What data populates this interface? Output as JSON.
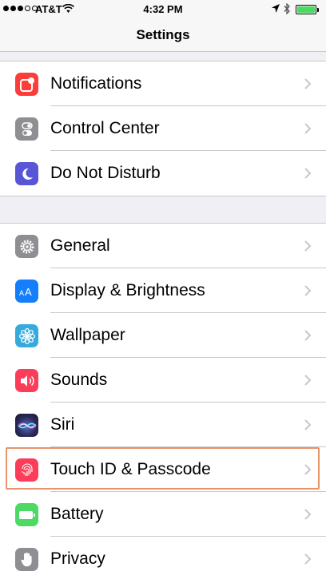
{
  "status_bar": {
    "carrier": "AT&T",
    "time": "4:32 PM",
    "signal_bars": 3,
    "signal_total": 5,
    "battery_level": 1.0,
    "battery_color": "#4cd964"
  },
  "nav": {
    "title": "Settings"
  },
  "groups": [
    {
      "items": [
        {
          "label": "Notifications",
          "icon": "notifications-icon",
          "color": "#fc3d39"
        },
        {
          "label": "Control Center",
          "icon": "control-center-icon",
          "color": "#8e8e93"
        },
        {
          "label": "Do Not Disturb",
          "icon": "moon-icon",
          "color": "#5856d6"
        }
      ]
    },
    {
      "items": [
        {
          "label": "General",
          "icon": "gear-icon",
          "color": "#8e8e93"
        },
        {
          "label": "Display & Brightness",
          "icon": "display-brightness-icon",
          "color": "#147efb"
        },
        {
          "label": "Wallpaper",
          "icon": "flower-icon",
          "color": "#36aadc"
        },
        {
          "label": "Sounds",
          "icon": "speaker-icon",
          "color": "#fc3d59"
        },
        {
          "label": "Siri",
          "icon": "siri-icon",
          "color": "#1c1c3a"
        },
        {
          "label": "Touch ID & Passcode",
          "icon": "fingerprint-icon",
          "color": "#fc3d59"
        },
        {
          "label": "Battery",
          "icon": "battery-icon",
          "color": "#4cd964"
        },
        {
          "label": "Privacy",
          "icon": "hand-icon",
          "color": "#8e8e93"
        }
      ]
    }
  ],
  "highlighted_item": "Touch ID & Passcode",
  "highlight_color": "#e8936a"
}
